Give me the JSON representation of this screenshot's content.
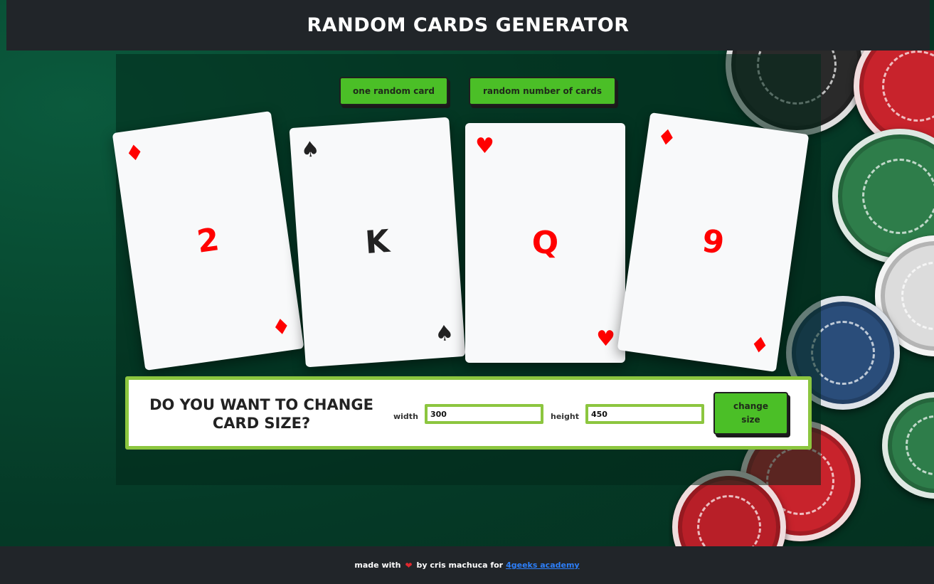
{
  "header": {
    "title": "Random Cards Generator"
  },
  "buttons": {
    "one_random": "one random card",
    "random_number": "random number of cards"
  },
  "cards": [
    {
      "value": "2",
      "suit": "♦",
      "color": "#ff0000"
    },
    {
      "value": "K",
      "suit": "♠",
      "color": "#222222"
    },
    {
      "value": "Q",
      "suit": "♥",
      "color": "#ff0000"
    },
    {
      "value": "9",
      "suit": "♦",
      "color": "#ff0000"
    }
  ],
  "size_form": {
    "question": "Do you want to change card size?",
    "width_label": "width",
    "width_value": "300",
    "height_label": "height",
    "height_value": "450",
    "change_button": "change size"
  },
  "footer": {
    "made_with": "made with",
    "heart": "❤",
    "by": "by Cris Machuca for",
    "link_text": "4Geeks Academy"
  },
  "colors": {
    "accent_green": "#4bbf27",
    "border_green": "#8cc63f",
    "dark_bar": "#212529",
    "link_blue": "#2d7ff9"
  }
}
